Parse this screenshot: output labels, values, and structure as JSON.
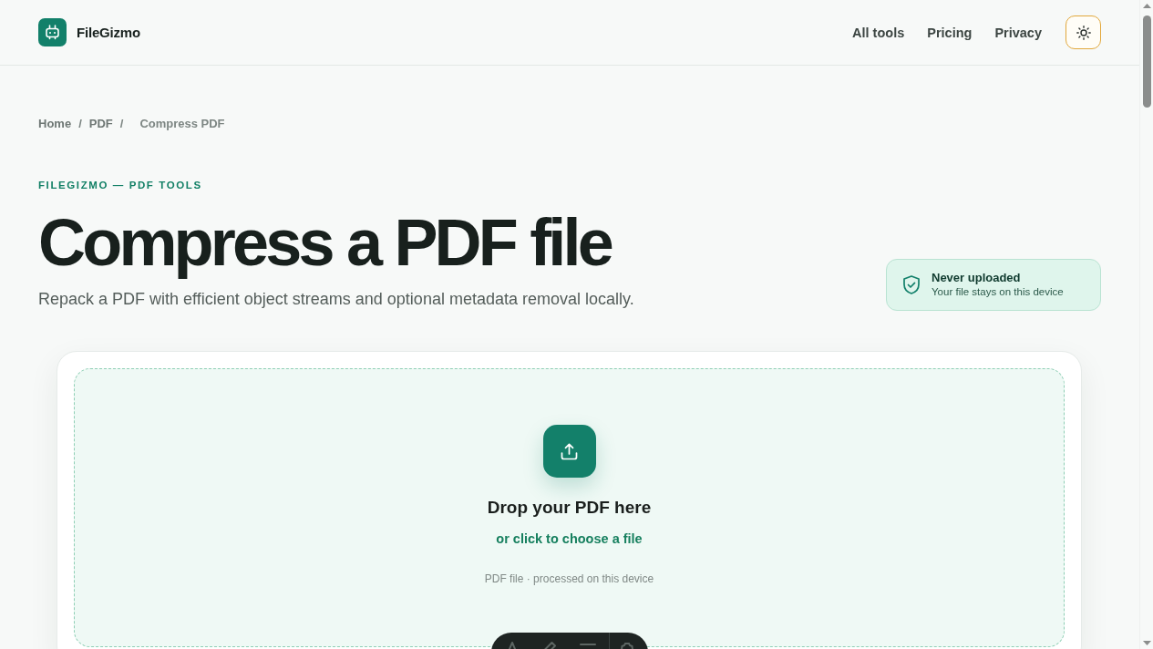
{
  "header": {
    "brand": "FileGizmo",
    "nav": [
      {
        "label": "All tools"
      },
      {
        "label": "Pricing"
      },
      {
        "label": "Privacy"
      }
    ]
  },
  "breadcrumb": [
    {
      "kind": "link",
      "text": "Home"
    },
    {
      "kind": "separator",
      "text": "/"
    },
    {
      "kind": "link",
      "text": "PDF"
    },
    {
      "kind": "separator",
      "text": "/"
    },
    {
      "kind": "current",
      "text": "Compress PDF"
    }
  ],
  "hero": {
    "eyebrow": "FILEGIZMO — PDF TOOLS",
    "title": "Compress a PDF file",
    "subtitle": "Repack a PDF with efficient object streams and optional metadata removal locally."
  },
  "privacy_badge": {
    "title": "Never uploaded",
    "text": "Your file stays on this device"
  },
  "dropzone": {
    "title": "Drop your PDF here",
    "link": "or click to choose a file",
    "hint": "PDF file · processed on this device"
  }
}
